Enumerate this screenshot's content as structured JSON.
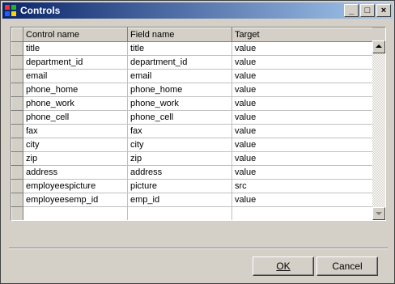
{
  "window": {
    "title": "Controls",
    "buttons": {
      "minimize": "_",
      "maximize": "□",
      "close": "×"
    }
  },
  "grid": {
    "columns": [
      "Control name",
      "Field name",
      "Target"
    ],
    "rows": [
      [
        "title",
        "title",
        "value"
      ],
      [
        "department_id",
        "department_id",
        "value"
      ],
      [
        "email",
        "email",
        "value"
      ],
      [
        "phone_home",
        "phone_home",
        "value"
      ],
      [
        "phone_work",
        "phone_work",
        "value"
      ],
      [
        "phone_cell",
        "phone_cell",
        "value"
      ],
      [
        "fax",
        "fax",
        "value"
      ],
      [
        "city",
        "city",
        "value"
      ],
      [
        "zip",
        "zip",
        "value"
      ],
      [
        "address",
        "address",
        "value"
      ],
      [
        "employeespicture",
        "picture",
        "src"
      ],
      [
        "employeesemp_id",
        "emp_id",
        "value"
      ],
      [
        "",
        "",
        ""
      ],
      [
        "",
        "",
        ""
      ]
    ]
  },
  "footer": {
    "ok_label": "OK",
    "cancel_label": "Cancel"
  }
}
